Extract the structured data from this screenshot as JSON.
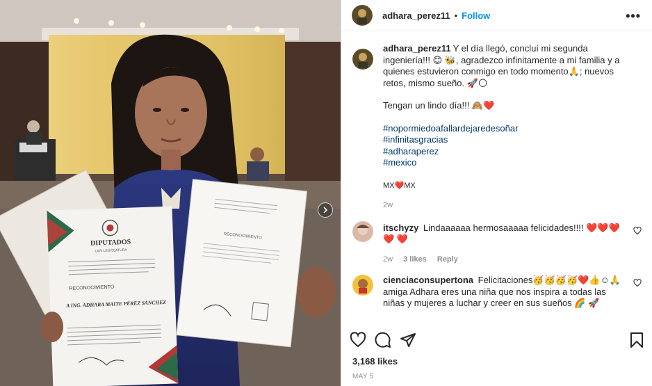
{
  "post": {
    "username": "adhara_perez11",
    "separator": "•",
    "follow_label": "Follow",
    "more_label": "•••",
    "likes": "3,168 likes",
    "date": "MAY 5"
  },
  "caption": {
    "username": "adhara_perez11",
    "line1": "Y el día llegó, concluí mi segunda ingeniería!!! 😊 🐝, agradezco infinitamente a mi familia y a quienes estuvieron conmigo en todo momento🙏; nuevos retos, mismo sueño. 🚀🌕",
    "line2": "Tengan un lindo día!!! 🙈❤️",
    "hashtags": [
      "#nopormiedoafallardejaredesoñar",
      "#infinitasgracias",
      "#adharaperez",
      "#mexico"
    ],
    "flags": "MX❤️MX",
    "time": "2w"
  },
  "comments": [
    {
      "username": "itschyzy",
      "text": "Lindaaaaaa hermosaaaaa felicidades!!!! ❤️❤️❤️❤️ ❤️",
      "time": "2w",
      "likes": "3 likes",
      "reply": "Reply"
    },
    {
      "username": "cienciaconsupertona",
      "text": "Felicitaciones🥳🥳🥳🥳❤️👍☺🙏 amiga Adhara eres una niña que nos inspira a todas las niñas y mujeres a luchar y creer en sus sueños 🌈 🚀"
    }
  ],
  "photo": {
    "certificate_left": {
      "institution": "DIPUTADOS",
      "legislature": "LXIV LEGISLATURA",
      "heading": "RECONOCIMIENTO",
      "recipient": "A ING. ADHARA MAITE PÉREZ SÁNCHEZ"
    },
    "certificate_right": {
      "heading": "RECONOCIMIENTO"
    }
  },
  "icons": [
    "heart-icon",
    "comment-icon",
    "share-icon",
    "bookmark-icon",
    "more-icon",
    "chevron-right-icon"
  ],
  "colors": {
    "accent": "#0095f6",
    "hashtag": "#00376b",
    "muted": "#8e8e8e",
    "heart": "#ed4956"
  }
}
